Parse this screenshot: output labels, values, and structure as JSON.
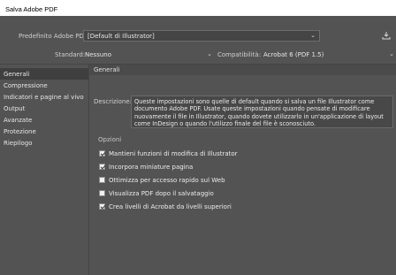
{
  "window": {
    "title": "Salva Adobe PDF"
  },
  "preset": {
    "label": "Predefinito Adobe PDF:",
    "value": "[Default di Illustrator]"
  },
  "standard": {
    "label": "Standard:",
    "value": "Nessuno"
  },
  "compat": {
    "label": "Compatibilità:",
    "value": "Acrobat 6 (PDF 1.5)"
  },
  "sidebar": {
    "items": [
      {
        "label": "Generali"
      },
      {
        "label": "Compressione"
      },
      {
        "label": "Indicatori e pagine al vivo"
      },
      {
        "label": "Output"
      },
      {
        "label": "Avanzate"
      },
      {
        "label": "Protezione"
      },
      {
        "label": "Riepilogo"
      }
    ]
  },
  "main": {
    "section_title": "Generali",
    "description_label": "Descrizione:",
    "description_text": "Queste impostazioni sono quelle di default quando si salva un file Illustrator come documento Adobe PDF. Usate queste impostazioni quando pensate di modificare nuovamente il file in Illustrator, quando dovete utilizzarlo in un'applicazione di layout come InDesign o quando l'utilizzo finale del file è sconosciuto.",
    "options_title": "Opzioni",
    "options": [
      {
        "label": "Mantieni funzioni di modifica di Illustrator",
        "checked": true
      },
      {
        "label": "Incorpora miniature pagina",
        "checked": true
      },
      {
        "label": "Ottimizza per accesso rapido sul Web",
        "checked": false
      },
      {
        "label": "Visualizza PDF dopo il salvataggio",
        "checked": false
      },
      {
        "label": "Crea livelli di Acrobat da livelli superiori",
        "checked": true
      }
    ]
  }
}
